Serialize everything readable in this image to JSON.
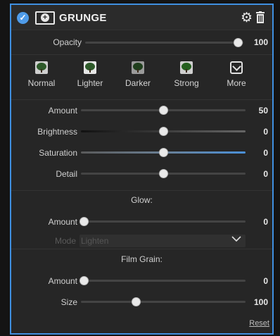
{
  "header": {
    "title": "GRUNGE",
    "icons": [
      "checkmark-circle-icon",
      "plus-circle-icon",
      "gear-icon",
      "trash-icon"
    ]
  },
  "opacity": {
    "label": "Opacity",
    "value": "100",
    "level": 1.0
  },
  "presets": [
    {
      "label": "Normal",
      "icon": "tree-thumbnail"
    },
    {
      "label": "Lighter",
      "icon": "tree-thumbnail"
    },
    {
      "label": "Darker",
      "icon": "tree-thumbnail"
    },
    {
      "label": "Strong",
      "icon": "tree-thumbnail"
    },
    {
      "label": "More",
      "icon": "chevron-down-box-icon"
    }
  ],
  "sliders": [
    {
      "label": "Amount",
      "value": "50",
      "level": 0.5
    },
    {
      "label": "Brightness",
      "value": "0",
      "level": 0.5
    },
    {
      "label": "Saturation",
      "value": "0",
      "level": 0.5
    },
    {
      "label": "Detail",
      "value": "0",
      "level": 0.5
    }
  ],
  "glow": {
    "title": "Glow:",
    "amount": {
      "label": "Amount",
      "value": "0",
      "level": 0.0
    },
    "mode": {
      "label": "Mode",
      "value": "Lighten"
    }
  },
  "film_grain": {
    "title": "Film Grain:",
    "amount": {
      "label": "Amount",
      "value": "0",
      "level": 0.0
    },
    "size": {
      "label": "Size",
      "value": "100",
      "level": 0.33
    }
  },
  "reset_label": "Reset",
  "colors": {
    "accent": "#3f8fe0",
    "saturation_track": "#4a90d8",
    "background": "#262626"
  }
}
